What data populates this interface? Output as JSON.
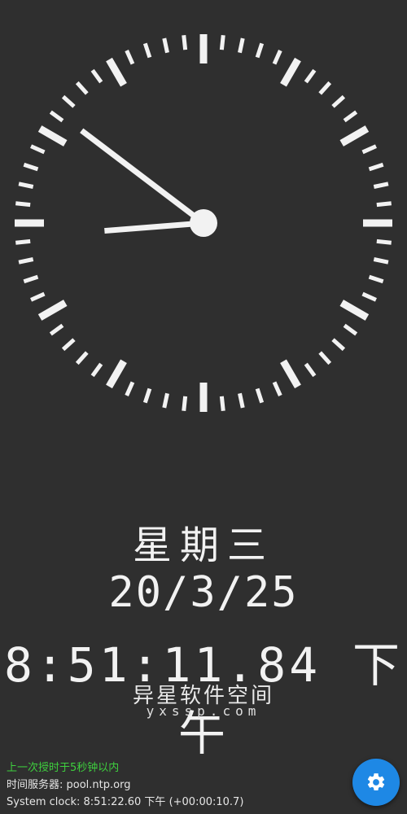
{
  "clock": {
    "hour": 8,
    "minute": 51,
    "second": 11.84,
    "face_color": "#2f2f2f",
    "tick_color": "#f2f2f2"
  },
  "display": {
    "weekday": "星期三",
    "date": "20/3/25",
    "time": "8:51:11.84 下午"
  },
  "watermark": {
    "name": "异星软件空间",
    "url": "yxssp.com"
  },
  "status": {
    "sync": "上一次授时于5秒钟以内",
    "server": "时间服务器: pool.ntp.org",
    "system_clock": "System clock: 8:51:22.60 下午 (+00:00:10.7)"
  },
  "settings": {
    "icon": "gear-icon",
    "color": "#1e88e5"
  }
}
